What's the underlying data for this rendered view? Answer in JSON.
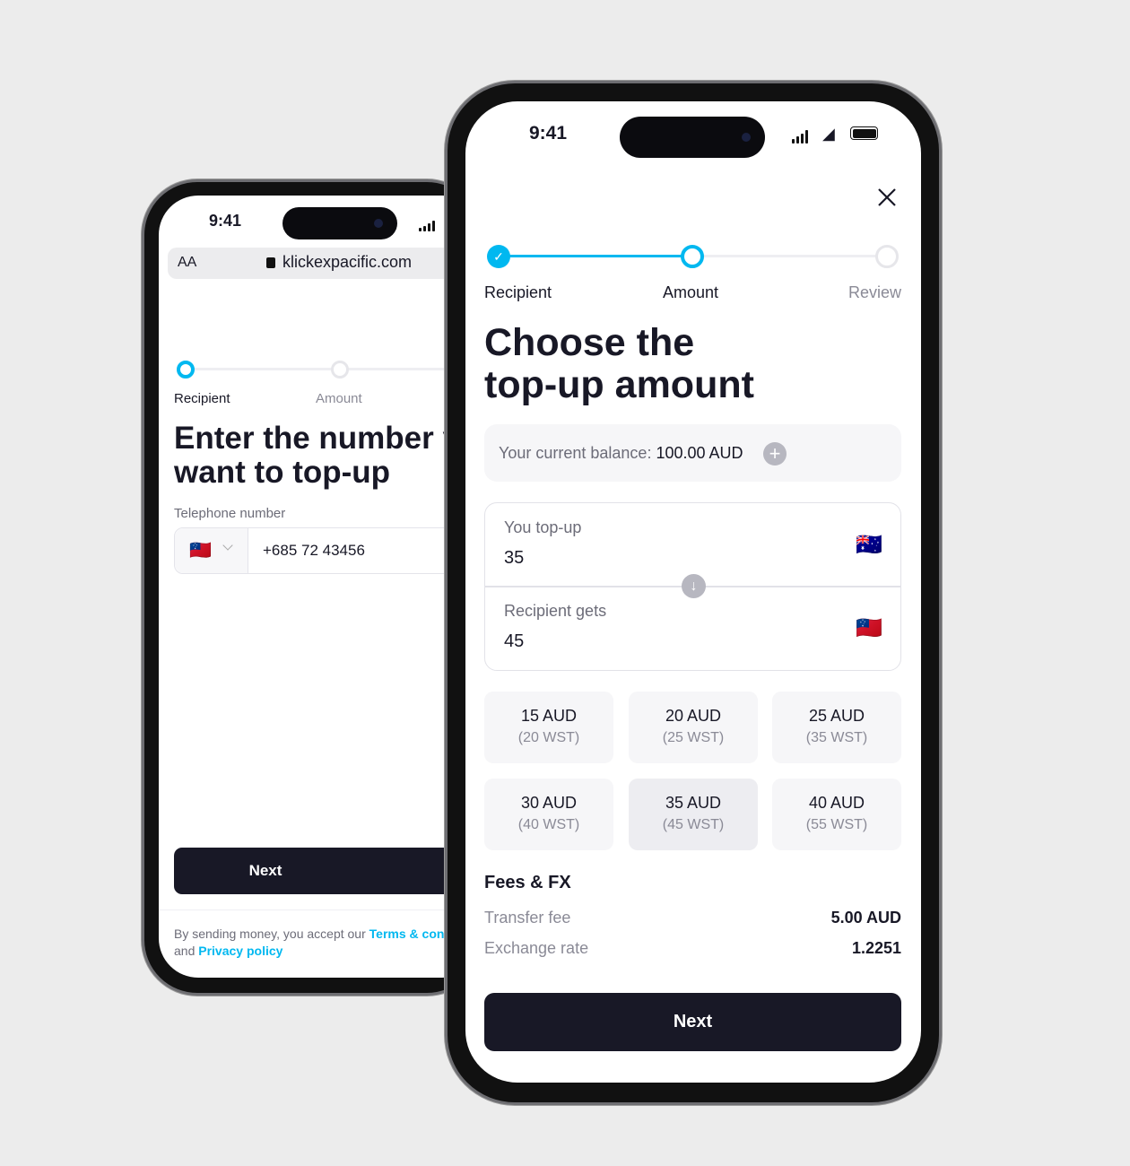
{
  "back_phone": {
    "status_time": "9:41",
    "browser": {
      "text_size": "AA",
      "url": "klickexpacific.com"
    },
    "steps": [
      "Recipient",
      "Amount"
    ],
    "title_line1": "Enter the number you",
    "title_line2": "want to top-up",
    "phone_label": "Telephone number",
    "country_flag": "🇼🇸",
    "phone_value": "+685 72 43456",
    "next_label": "Next",
    "legal_prefix": "By sending money, you accept our ",
    "terms_link": "Terms & conditions",
    "legal_and": "and ",
    "privacy_link": "Privacy policy"
  },
  "front_phone": {
    "status_time": "9:41",
    "steps": [
      "Recipient",
      "Amount",
      "Review"
    ],
    "title_line1": "Choose the",
    "title_line2": "top-up amount",
    "balance_label": "Your current balance:",
    "balance_value": "100.00 AUD",
    "topup_label": "You top-up",
    "topup_value": "35",
    "topup_flag": "🇦🇺",
    "recipient_label": "Recipient gets",
    "recipient_value": "45",
    "recipient_flag": "🇼🇸",
    "options": [
      {
        "aud": "15 AUD",
        "wst": "(20 WST)"
      },
      {
        "aud": "20 AUD",
        "wst": "(25 WST)"
      },
      {
        "aud": "25 AUD",
        "wst": "(35 WST)"
      },
      {
        "aud": "30 AUD",
        "wst": "(40 WST)"
      },
      {
        "aud": "35 AUD",
        "wst": "(45 WST)",
        "selected": true
      },
      {
        "aud": "40 AUD",
        "wst": "(55 WST)"
      }
    ],
    "fees_title": "Fees & FX",
    "transfer_fee_label": "Transfer fee",
    "transfer_fee_value": "5.00 AUD",
    "exchange_rate_label": "Exchange rate",
    "exchange_rate_value": "1.2251",
    "next_label": "Next"
  },
  "colors": {
    "accent": "#00b8f0",
    "button": "#181826",
    "background": "#ececec"
  }
}
